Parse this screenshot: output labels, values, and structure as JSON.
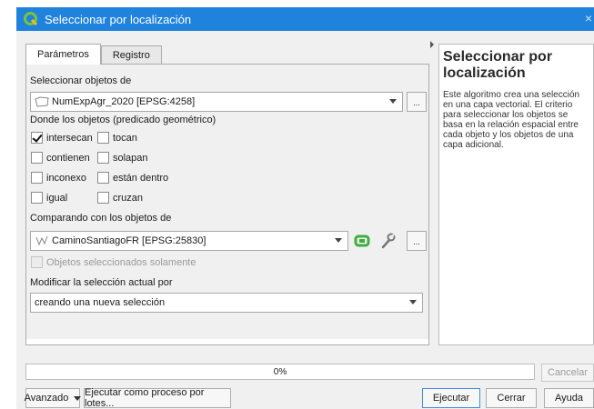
{
  "window": {
    "title": "Seleccionar por localización",
    "close_icon": "×"
  },
  "tabs": [
    {
      "label": "Parámetros",
      "active": true
    },
    {
      "label": "Registro",
      "active": false
    }
  ],
  "params": {
    "select_label": "Seleccionar objetos de",
    "select_layer": "NumExpAgr_2020 [EPSG:4258]",
    "predicate_label": "Donde los objetos (predicado geométrico)",
    "predicates": [
      {
        "label": "intersecan",
        "checked": true
      },
      {
        "label": "tocan",
        "checked": false
      },
      {
        "label": "contienen",
        "checked": false
      },
      {
        "label": "solapan",
        "checked": false
      },
      {
        "label": "inconexo",
        "checked": false
      },
      {
        "label": "están dentro",
        "checked": false
      },
      {
        "label": "igual",
        "checked": false
      },
      {
        "label": "cruzan",
        "checked": false
      }
    ],
    "compare_label": "Comparando con los objetos de",
    "compare_layer": "CaminoSantiagoFR [EPSG:25830]",
    "selected_only_label": "Objetos seleccionados solamente",
    "modify_label": "Modificar la selección actual por",
    "modify_value": "creando una nueva selección",
    "dots": "..."
  },
  "help": {
    "title": "Seleccionar por localización",
    "text": "Este algoritmo crea una selección en una capa vectorial. El criterio para seleccionar los objetos se basa en la relación espacial entre cada objeto y los objetos de una capa adicional."
  },
  "progress": {
    "value": "0%"
  },
  "buttons": {
    "cancel": "Cancelar",
    "advanced": "Avanzado",
    "batch": "Ejecutar como proceso por lotes...",
    "run": "Ejecutar",
    "close": "Cerrar",
    "help": "Ayuda"
  },
  "colors": {
    "titlebar": "#1f82dd",
    "qgis_green": "#589632",
    "iterate_green": "#3fae3f"
  }
}
